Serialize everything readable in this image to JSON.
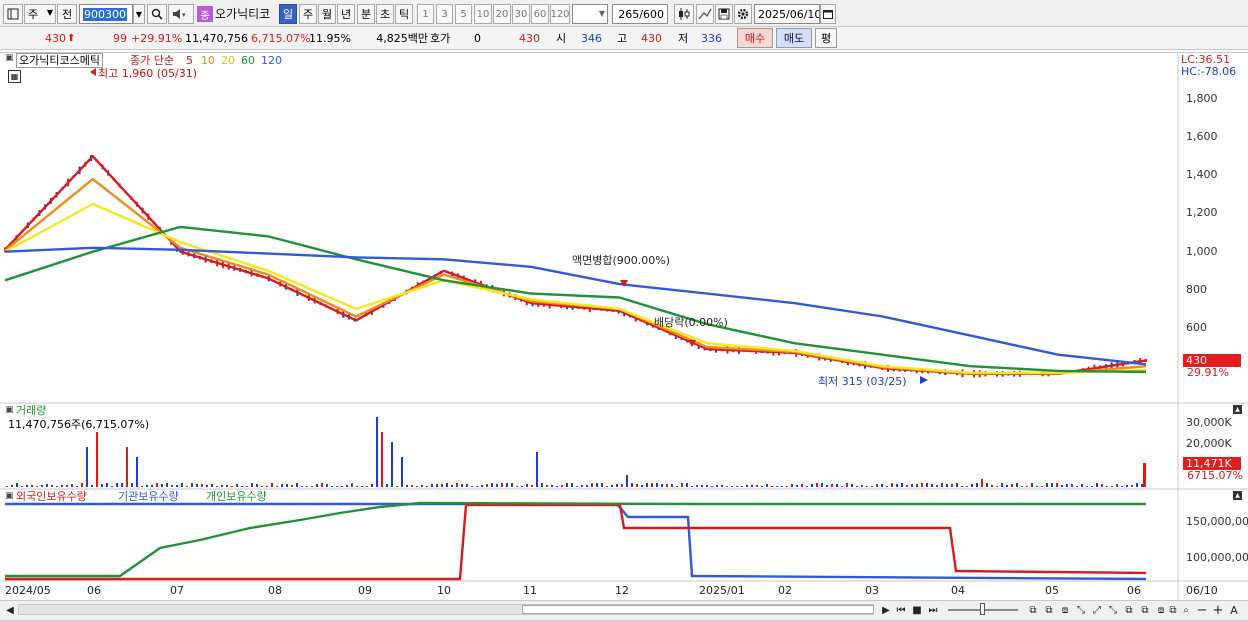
{
  "toolbar": {
    "period_label": "주",
    "prev_label": "전",
    "code_value": "900300",
    "stock_name": "오가닉티코",
    "type_badge": "종",
    "periods": [
      "일",
      "주",
      "월",
      "년",
      "분",
      "초",
      "틱"
    ],
    "numbers": [
      "1",
      "3",
      "5",
      "10",
      "20",
      "30",
      "60",
      "120"
    ],
    "count_value": "265",
    "count_total": "/600",
    "date_value": "2025/06/10"
  },
  "quote": {
    "price": "430",
    "change": "99",
    "change_pct": "+29.91%",
    "volume": "11,470,756",
    "volume_pct": "6,715.07%",
    "turnover": "11.95%",
    "amount": "4,825백만",
    "ask_label": "호가",
    "ask_value": "0",
    "bid_value": "430",
    "open_label": "시",
    "open_value": "346",
    "high_label": "고",
    "high_value": "430",
    "low_label": "저",
    "low_value": "336",
    "buy_label": "매수",
    "sell_label": "매도",
    "avg_label": "평"
  },
  "price_panel": {
    "name_tag": "오가닉티코스메틱",
    "ma_label": "종가 단순",
    "ma_periods": [
      "5",
      "10",
      "20",
      "60",
      "120"
    ],
    "lc_label": "LC:36.51",
    "hc_label": "HC:-78.06",
    "y_ticks": [
      "1,800",
      "1,600",
      "1,400",
      "1,200",
      "1,000",
      "800",
      "600"
    ],
    "current_price_tag": "430",
    "current_pct_tag": "29.91%",
    "annotations": {
      "high": "최고 1,960 (05/31)",
      "split": "액면병합(900.00%)",
      "dividend": "배당락(0.00%)",
      "low": "최저 315 (03/25)"
    }
  },
  "volume_panel": {
    "title": "거래량",
    "value_label": "11,470,756주(6,715.07%)",
    "y_ticks": [
      "30,000K",
      "20,000K"
    ],
    "current_tag": "11,471K",
    "current_pct_tag": "6715.07%"
  },
  "holdings_panel": {
    "labels": [
      "외국인보유수량",
      "기관보유수량",
      "개인보유수량"
    ],
    "y_ticks": [
      "150,000,00",
      "100,000,00"
    ]
  },
  "x_axis": [
    "2024/05",
    "06",
    "07",
    "08",
    "09",
    "10",
    "11",
    "12",
    "2025/01",
    "02",
    "03",
    "04",
    "05",
    "06"
  ],
  "x_axis_end": "06/10",
  "colors": {
    "up": "#d81c1c",
    "down": "#1c3cd8",
    "ma5": "#d81c1c",
    "ma10": "#f08c1e",
    "ma20": "#f5e81e",
    "ma60": "#22923a",
    "ma120": "#2f5ad8",
    "foreign": "#d81c1c",
    "institution": "#2f5ad8",
    "individual": "#22923a"
  },
  "chart_data": {
    "type": "line",
    "x": [
      "2024/05",
      "06",
      "07",
      "08",
      "09",
      "10",
      "11",
      "12",
      "2025/01",
      "02",
      "03",
      "04",
      "05",
      "06"
    ],
    "ylim": [
      336,
      1960
    ],
    "series": [
      {
        "name": "5",
        "values": [
          1010,
          1500,
          1000,
          860,
          640,
          900,
          730,
          690,
          490,
          470,
          390,
          360,
          360,
          430
        ]
      },
      {
        "name": "10",
        "values": [
          1005,
          1380,
          1020,
          880,
          660,
          880,
          740,
          700,
          500,
          475,
          395,
          362,
          362,
          400
        ]
      },
      {
        "name": "20",
        "values": [
          1000,
          1250,
          1050,
          900,
          700,
          850,
          750,
          700,
          520,
          480,
          400,
          365,
          365,
          380
        ]
      },
      {
        "name": "60",
        "values": [
          850,
          1000,
          1130,
          1080,
          960,
          850,
          780,
          760,
          620,
          520,
          460,
          400,
          375,
          370
        ]
      },
      {
        "name": "120",
        "values": [
          1000,
          1020,
          1010,
          990,
          970,
          960,
          920,
          830,
          780,
          730,
          660,
          560,
          460,
          410
        ]
      }
    ],
    "annotations": [
      "최고 1,960 (05/31)",
      "최저 315 (03/25)",
      "액면병합(900.00%)",
      "배당락(0.00%)"
    ]
  }
}
